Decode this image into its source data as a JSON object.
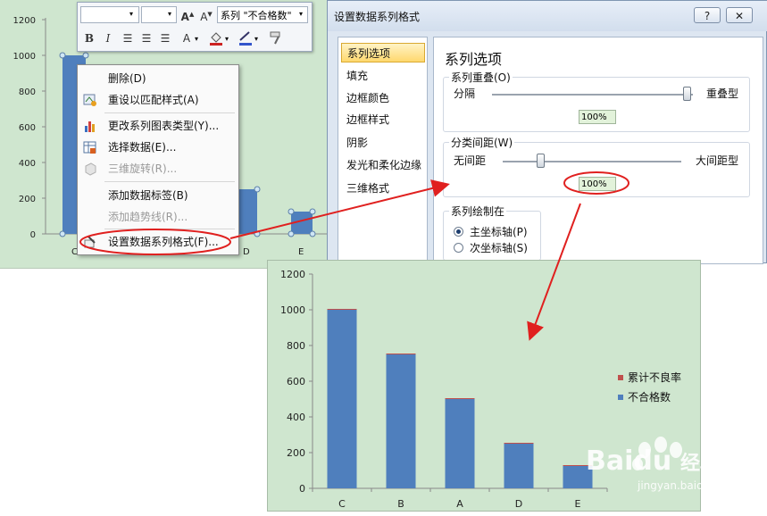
{
  "bg_chart": {
    "ytick_labels": [
      "1200",
      "1000",
      "800",
      "600",
      "400",
      "200",
      "0"
    ],
    "xtick_labels": [
      "C",
      "D",
      "E"
    ]
  },
  "mini_toolbar": {
    "font_value": "",
    "size_value": "",
    "series_selector": "系列 \"不合格数\"",
    "bold": "B",
    "italic": "I"
  },
  "context_menu": {
    "items": [
      {
        "label": "删除(D)",
        "icon": "",
        "enabled": true
      },
      {
        "label": "重设以匹配样式(A)",
        "icon": "reset-style-icon",
        "enabled": true
      },
      {
        "label": "更改系列图表类型(Y)...",
        "icon": "chart-type-icon",
        "enabled": true
      },
      {
        "label": "选择数据(E)...",
        "icon": "select-data-icon",
        "enabled": true
      },
      {
        "label": "三维旋转(R)...",
        "icon": "rotate-3d-icon",
        "enabled": false
      },
      {
        "label": "添加数据标签(B)",
        "icon": "",
        "enabled": true
      },
      {
        "label": "添加趋势线(R)...",
        "icon": "",
        "enabled": false
      },
      {
        "label": "设置数据系列格式(F)...",
        "icon": "format-series-icon",
        "enabled": true
      }
    ]
  },
  "dialog": {
    "title": "设置数据系列格式",
    "help_button": "?",
    "close_button": "✕",
    "nav": [
      "系列选项",
      "填充",
      "边框颜色",
      "边框样式",
      "阴影",
      "发光和柔化边缘",
      "三维格式"
    ],
    "selected_nav": "系列选项",
    "panel_heading": "系列选项",
    "overlap": {
      "title": "系列重叠(O)",
      "left": "分隔",
      "right": "重叠型",
      "value": "100%",
      "level": 1.0
    },
    "gap": {
      "title": "分类间距(W)",
      "left": "无间距",
      "right": "大间距型",
      "value": "100%",
      "level": 0.2
    },
    "plot_on": {
      "title": "系列绘制在",
      "primary": "主坐标轴(P)",
      "secondary": "次坐标轴(S)",
      "selected": "primary"
    }
  },
  "chart_data": {
    "type": "bar",
    "categories": [
      "C",
      "B",
      "A",
      "D",
      "E"
    ],
    "series": [
      {
        "name": "不合格数",
        "values": [
          1000,
          750,
          500,
          250,
          125
        ],
        "color": "#4f7fbd"
      },
      {
        "name": "累计不良率",
        "values": [
          5,
          5,
          5,
          5,
          5
        ],
        "color": "#c0504d"
      }
    ],
    "ylim": [
      0,
      1200
    ],
    "yticks": [
      "0",
      "200",
      "400",
      "600",
      "800",
      "1000",
      "1200"
    ],
    "legend": "right",
    "stacked": true
  },
  "watermark": {
    "brand": "Baidu",
    "cn": "经验",
    "url": "jingyan.baidu.com"
  },
  "colors": {
    "chart_bg": "#cfe6cf",
    "bar_blue": "#4f7fbd",
    "bar_red": "#c0504d",
    "annotation_red": "#e0201f"
  }
}
